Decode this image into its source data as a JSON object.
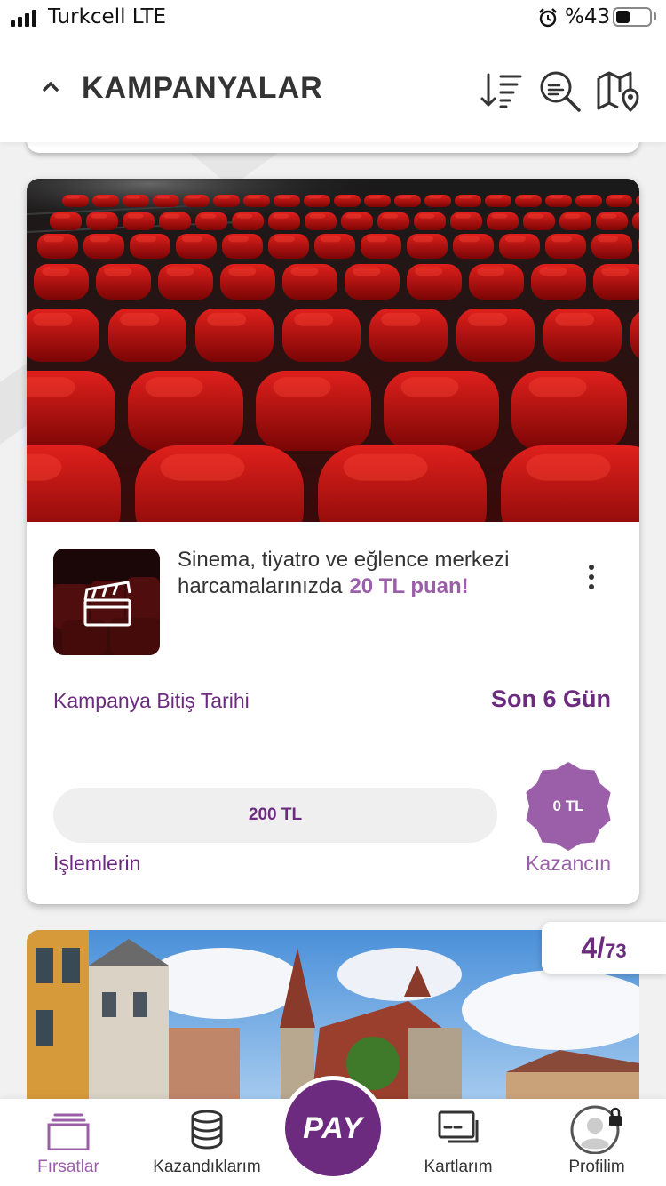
{
  "status_bar": {
    "carrier": "Turkcell LTE",
    "battery_text": "%43",
    "battery_level": 0.43
  },
  "header": {
    "title": "KAMPANYALAR",
    "icons": [
      "chevron-up-icon",
      "sort-icon",
      "search-icon",
      "map-icon"
    ]
  },
  "campaign": {
    "description": "Sinema, tiyatro ve eğlence merkezi harcamalarınızda",
    "highlight": "20 TL puan!",
    "end_label": "Kampanya Bitiş Tarihi",
    "end_value": "Son 6 Gün",
    "progress_label": "200 TL",
    "progress_fraction": 0,
    "earned_value": "0 TL",
    "transactions_label": "İşlemlerin",
    "earned_label": "Kazancın",
    "thumbnail_icon": "clapperboard-icon"
  },
  "page_counter": {
    "current": "4",
    "separator": "/",
    "total": "73"
  },
  "tabbar": {
    "tabs": [
      {
        "label": "Fırsatlar",
        "icon": "cards-icon",
        "active": true
      },
      {
        "label": "Kazandıklarım",
        "icon": "coins-icon",
        "active": false
      },
      {
        "label": "PAY",
        "icon": "pay-icon",
        "active": false
      },
      {
        "label": "Kartlarım",
        "icon": "card-icon",
        "active": false
      },
      {
        "label": "Profilim",
        "icon": "profile-lock-icon",
        "active": false
      }
    ]
  },
  "colors": {
    "brand": "#6c2b7f",
    "accent": "#9b5fa9",
    "seat_red": "#b30f0f"
  }
}
